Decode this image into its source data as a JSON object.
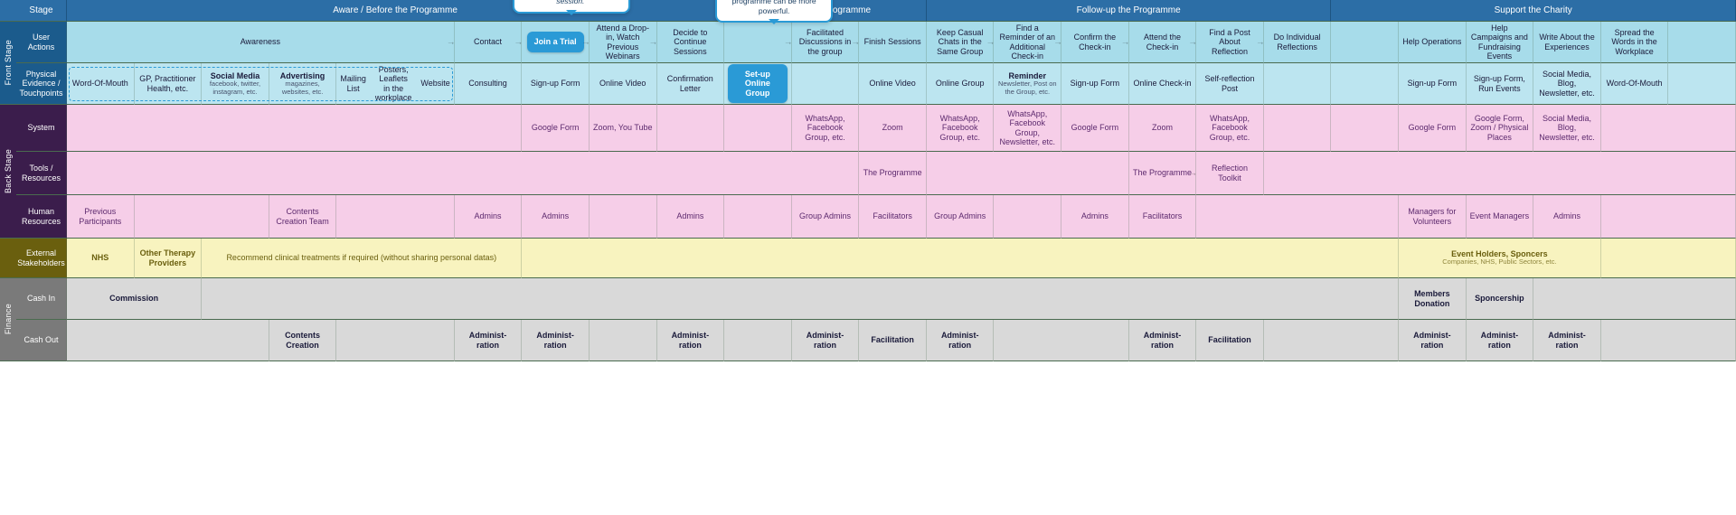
{
  "sideGroups": {
    "frontStage": "Front Stage",
    "backStage": "Back Stage",
    "finance": "Finance"
  },
  "rowLabels": {
    "stage": "Stage",
    "userActions": "User Actions",
    "touchpoints": "Physical Evidence / Touchpoints",
    "system": "System",
    "tools": "Tools / Resources",
    "human": "Human Resources",
    "external": "External Stakeholders",
    "cashIn": "Cash In",
    "cashOut": "Cash Out"
  },
  "phases": {
    "aware": "Aware / Before the Programme",
    "during": "During the Programme",
    "followUp": "Follow-up the Programme",
    "support": "Support the Charity"
  },
  "userActions": {
    "awareness": "Awareness",
    "contact": "Contact",
    "joinTrial": "Join a Trial",
    "attendDropIn": "Attend a Drop-in, Watch Previous Webinars",
    "decideContinue": "Decide to Continue Sessions",
    "setupGroup": "Set-up Online Group",
    "facilitated": "Facilitated Discussions in the group",
    "finishSessions": "Finish Sessions",
    "keepChats": "Keep Casual Chats in the Same Group",
    "findReminder": "Find a Reminder of an Additional Check-in",
    "confirmCheckin": "Confirm the Check-in",
    "attendCheckin": "Attend the Check-in",
    "findPost": "Find a Post About Reflection",
    "doReflections": "Do Individual Reflections",
    "helpOps": "Help Operations",
    "helpCampaigns": "Help  Campaigns and Fundraising Events",
    "writeAbout": "Write About the Experiences",
    "spreadWords": "Spread the Words in the Workplace"
  },
  "touchpoints": {
    "wordOfMouth": "Word-Of-Mouth",
    "gp": "GP, Practitioner Health, etc.",
    "social": {
      "main": "Social Media",
      "sub": "facebook, twitter, instagram, etc."
    },
    "advertising": {
      "main": "Advertising",
      "sub": "magazines, websites, etc."
    },
    "mailingList": "Mailing List",
    "posters": "Posters, Leaflets in the workplace",
    "website": "Website",
    "consulting": "Consulting",
    "signupForm": "Sign-up Form",
    "onlineVideo": "Online Video",
    "confirmation": "Confirmation Letter",
    "onlineGroup": "Online Group",
    "reminder": {
      "main": "Reminder",
      "sub": "Newsletter, Post on the Group, etc."
    },
    "onlineCheckin": "Online Check-in",
    "selfReflection": "Self-reflection Post",
    "signupRun": "Sign-up Form, Run Events",
    "socialBlog": "Social Media, Blog, Newsletter, etc."
  },
  "system": {
    "googleForm": "Google Form",
    "zoomYouTube": "Zoom, You Tube",
    "whatsapp": "WhatsApp, Facebook Group, etc.",
    "zoom": "Zoom",
    "whatsappNews": "WhatsApp, Facebook Group, Newsletter, etc.",
    "gFormZoom": "Google Form, Zoom / Physical Places",
    "socialBlog": "Social Media, Blog, Newsletter, etc."
  },
  "tools": {
    "programme": "The Programme",
    "reflection": "Reflection Toolkit"
  },
  "human": {
    "prevParticipants": "Previous Participants",
    "contentTeam": "Contents Creation Team",
    "admins": "Admins",
    "groupAdmins": "Group Admins",
    "facilitators": "Facilitators",
    "managers": "Managers for Volunteers",
    "eventManagers": "Event Managers"
  },
  "external": {
    "nhs": "NHS",
    "otherTherapy": "Other Therapy Providers",
    "recommend": "Recommend clinical treatments if required (without sharing personal datas)",
    "eventHolders": {
      "main": "Event Holders, Sponcers",
      "sub": "Companies, NHS, Public Sectors, etc."
    }
  },
  "cashIn": {
    "commission": "Commission",
    "donation": "Members Donation",
    "sponcership": "Sponcership"
  },
  "cashOut": {
    "contents": "Contents Creation",
    "admin": "Administ-ration",
    "facilitation": "Facilitation"
  },
  "callouts": {
    "worried": "\"I feel so worried when someone drop out from the session.\"",
    "integrating": "Integrating building the online community into the programme can be more powerful."
  }
}
